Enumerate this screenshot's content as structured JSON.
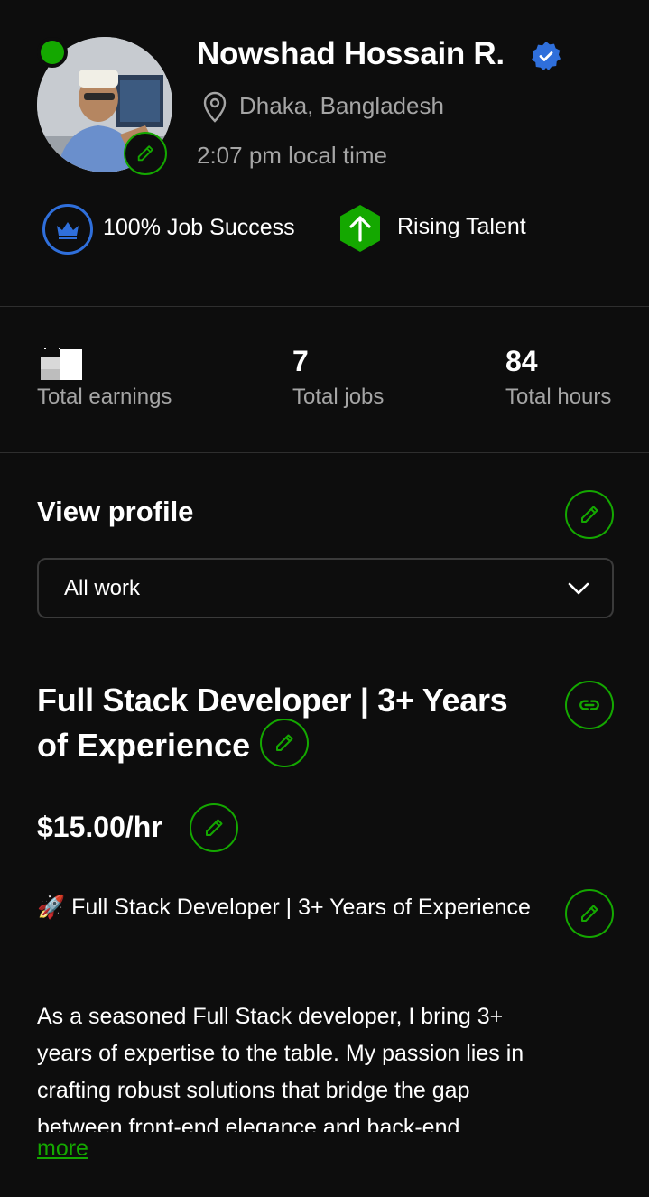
{
  "profile": {
    "name": "Nowshad Hossain R.",
    "location": "Dhaka, Bangladesh",
    "local_time": "2:07 pm local time",
    "job_success": "100% Job Success",
    "rising_talent": "Rising Talent"
  },
  "stats": {
    "earnings_label": "Total earnings",
    "jobs_value": "7",
    "jobs_label": "Total jobs",
    "hours_value": "84",
    "hours_label": "Total hours"
  },
  "view_profile": {
    "title": "View profile",
    "select_value": "All work"
  },
  "listing": {
    "headline_line1": "Full Stack Developer | 3+ Years",
    "headline_line2": "of Experience",
    "rate": "$15.00/hr",
    "overview_title": "🚀 Full Stack Developer | 3+ Years of Experience",
    "overview_text": "As a seasoned Full Stack developer, I bring 3+ years of expertise to the table. My passion lies in crafting robust solutions that bridge the gap between front-end elegance and back-end…",
    "more_label": "more"
  },
  "colors": {
    "background": "#0d0d0d",
    "accent_green": "#14a800",
    "verified_blue": "#2f6fdb",
    "muted_text": "#a5a5a5"
  },
  "icons": [
    "pencil-icon",
    "verified-badge-icon",
    "location-pin-icon",
    "crown-icon",
    "arrow-up-icon",
    "link-icon",
    "chevron-down-icon"
  ]
}
